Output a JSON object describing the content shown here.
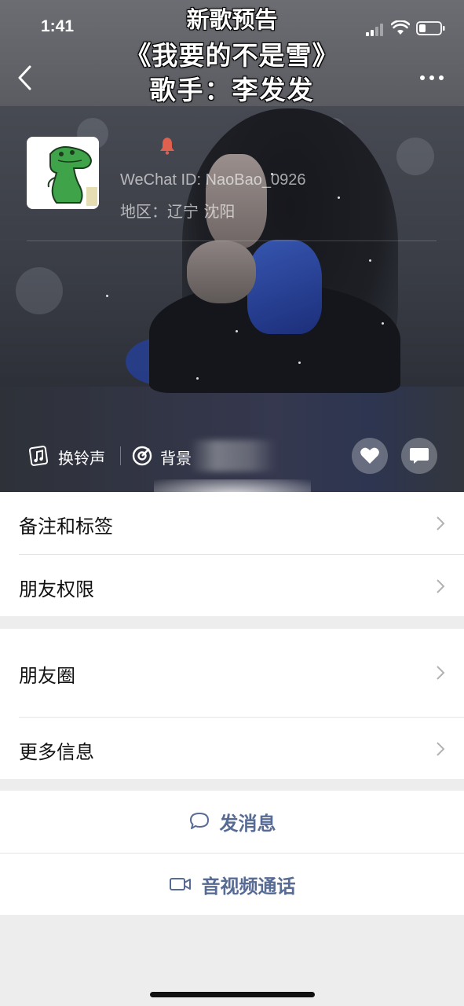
{
  "status_bar": {
    "time": "1:41"
  },
  "overlay": {
    "line1": "新歌预告",
    "line2": "《我要的不是雪》",
    "line3": "歌手：李发发"
  },
  "profile": {
    "wechat_id": "WeChat ID: NaoBao_0926",
    "region": "地区：辽宁 沈阳"
  },
  "ringtone": {
    "change_ringtone": "换铃声",
    "background": "背景"
  },
  "list": {
    "remarks_tags": "备注和标签",
    "friend_permissions": "朋友权限",
    "moments": "朋友圈",
    "more_info": "更多信息"
  },
  "actions": {
    "send_message": "发消息",
    "video_call": "音视频通话"
  },
  "colors": {
    "link_blue": "#576b95",
    "list_bg": "#ededed"
  }
}
